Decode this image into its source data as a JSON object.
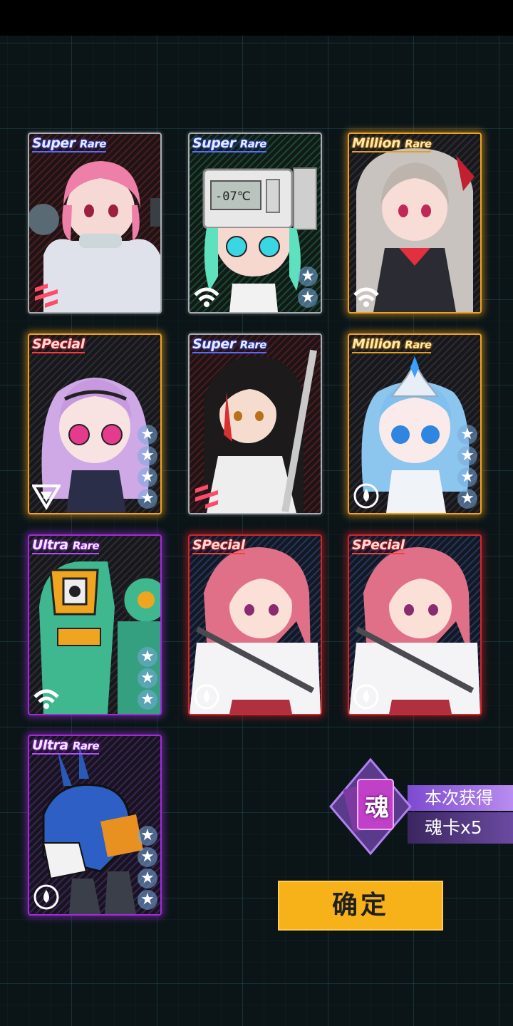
{
  "cards": [
    {
      "rarity_main": "Super",
      "rarity_sub": "Rare",
      "tier": "super",
      "frame": "silver",
      "stars": 0,
      "attribute": "stripe-icon"
    },
    {
      "rarity_main": "Super",
      "rarity_sub": "Rare",
      "tier": "super",
      "frame": "silver",
      "stars": 2,
      "attribute": "wifi-icon",
      "screen_text": "-07℃"
    },
    {
      "rarity_main": "Million",
      "rarity_sub": "Rare",
      "tier": "million",
      "frame": "gold",
      "stars": 0,
      "attribute": "wifi-icon"
    },
    {
      "rarity_main": "SPecial",
      "rarity_sub": "",
      "tier": "special",
      "frame": "gold",
      "stars": 4,
      "attribute": "triangle-icon"
    },
    {
      "rarity_main": "Super",
      "rarity_sub": "Rare",
      "tier": "super",
      "frame": "silver",
      "stars": 0,
      "attribute": "stripe-icon"
    },
    {
      "rarity_main": "Million",
      "rarity_sub": "Rare",
      "tier": "million",
      "frame": "gold",
      "stars": 4,
      "attribute": "drop-icon"
    },
    {
      "rarity_main": "Ultra",
      "rarity_sub": "Rare",
      "tier": "ultra",
      "frame": "purple",
      "stars": 3,
      "attribute": "wifi-icon"
    },
    {
      "rarity_main": "SPecial",
      "rarity_sub": "",
      "tier": "special",
      "frame": "red",
      "stars": 0,
      "attribute": "drop-icon"
    },
    {
      "rarity_main": "SPecial",
      "rarity_sub": "",
      "tier": "special",
      "frame": "red",
      "stars": 0,
      "attribute": "drop-icon"
    },
    {
      "rarity_main": "Ultra",
      "rarity_sub": "Rare",
      "tier": "ultra",
      "frame": "purple",
      "stars": 4,
      "attribute": "drop-icon"
    }
  ],
  "soul_reward": {
    "badge_char": "魂",
    "label": "本次获得",
    "count": "魂卡x5"
  },
  "confirm_label": "确定",
  "colors": {
    "gold": "#f0a320",
    "red": "#d0272c",
    "purple": "#a22cd8",
    "button": "#f7b21a"
  }
}
